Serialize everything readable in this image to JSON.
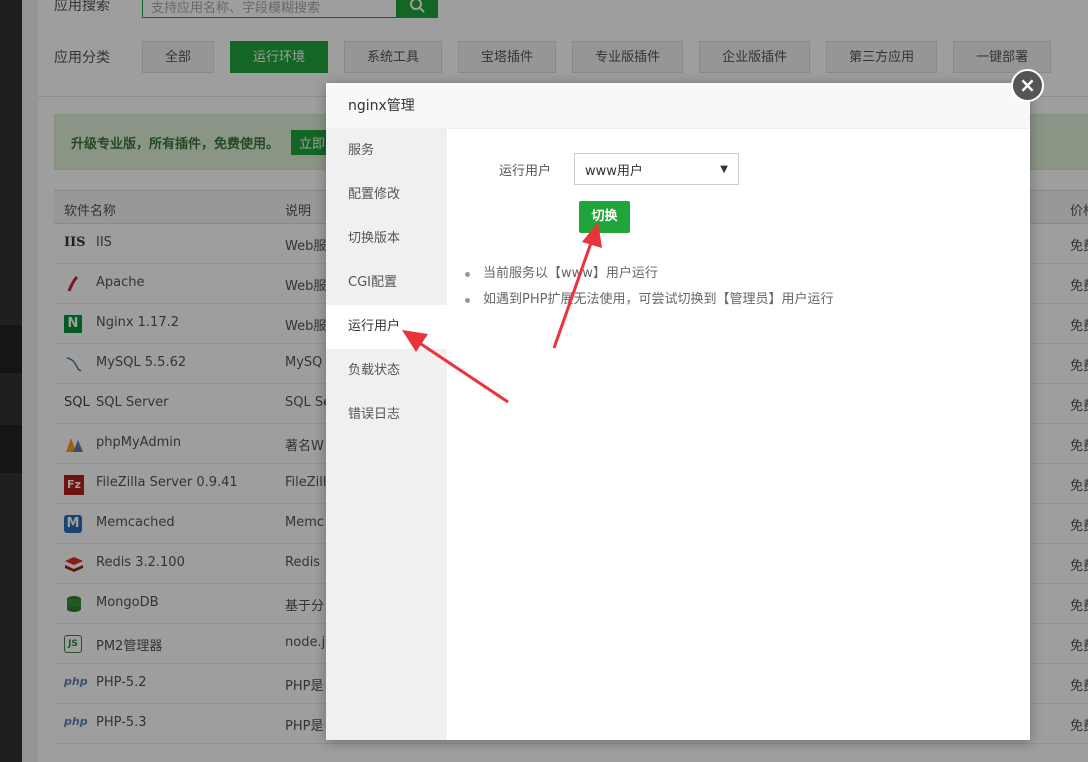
{
  "background": {
    "search": {
      "label": "应用搜索",
      "placeholder": "支持应用名称、字段模糊搜索"
    },
    "categories": {
      "label": "应用分类",
      "items": [
        "全部",
        "运行环境",
        "系统工具",
        "宝塔插件",
        "专业版插件",
        "企业版插件",
        "第三方应用",
        "一键部署"
      ],
      "active_index": 1
    },
    "promo": {
      "text": "升级专业版，所有插件，免费使用。",
      "button": "立即"
    },
    "table": {
      "headers": {
        "name": "软件名称",
        "desc": "说明",
        "price": "价格"
      },
      "rows": [
        {
          "icon": "iis-icon",
          "icon_text": "IIS",
          "name": "IIS",
          "desc": "Web服",
          "price": "免费"
        },
        {
          "icon": "apache-feather-icon",
          "icon_text": "",
          "name": "Apache",
          "desc": "Web服",
          "price": "免费"
        },
        {
          "icon": "nginx-icon",
          "icon_text": "N",
          "name": "Nginx 1.17.2",
          "desc": "Web服",
          "price": "免费"
        },
        {
          "icon": "mysql-dolphin-icon",
          "icon_text": "",
          "name": "MySQL 5.5.62",
          "desc": "MySQ",
          "price": "免费"
        },
        {
          "icon": "sql-server-icon",
          "icon_text": "SQL",
          "name": "SQL Server",
          "desc": "SQL Se",
          "price": "免费"
        },
        {
          "icon": "phpmyadmin-icon",
          "icon_text": "",
          "name": "phpMyAdmin",
          "desc": "著名W",
          "price": "免费"
        },
        {
          "icon": "filezilla-icon",
          "icon_text": "Fz",
          "name": "FileZilla Server 0.9.41",
          "desc": "FileZill",
          "price": "免费"
        },
        {
          "icon": "memcached-icon",
          "icon_text": "M",
          "name": "Memcached",
          "desc": "Memc",
          "price": "免费"
        },
        {
          "icon": "redis-icon",
          "icon_text": "",
          "name": "Redis 3.2.100",
          "desc": "Redis",
          "price": "免费"
        },
        {
          "icon": "mongodb-icon",
          "icon_text": "",
          "name": "MongoDB",
          "desc": "基于分",
          "price": "免费"
        },
        {
          "icon": "nodejs-icon",
          "icon_text": "JS",
          "name": "PM2管理器",
          "desc": "node.j",
          "price": "免费"
        },
        {
          "icon": "php-icon",
          "icon_text": "php",
          "name": "PHP-5.2",
          "desc": "PHP是",
          "price": "免费"
        },
        {
          "icon": "php-icon",
          "icon_text": "php",
          "name": "PHP-5.3",
          "desc": "PHP是",
          "price": "免费"
        }
      ]
    }
  },
  "modal": {
    "title": "nginx管理",
    "close_icon": "close-icon",
    "nav": [
      "服务",
      "配置修改",
      "切换版本",
      "CGI配置",
      "运行用户",
      "负载状态",
      "错误日志"
    ],
    "active_nav_index": 4,
    "run_user": {
      "label": "运行用户",
      "selected": "www用户"
    },
    "switch_button": "切换",
    "tips": [
      "当前服务以【www】用户运行",
      "如遇到PHP扩展无法使用，可尝试切换到【管理员】用户运行"
    ]
  },
  "colors": {
    "accent": "#20a53a",
    "annotation_arrow": "#e8343a"
  }
}
